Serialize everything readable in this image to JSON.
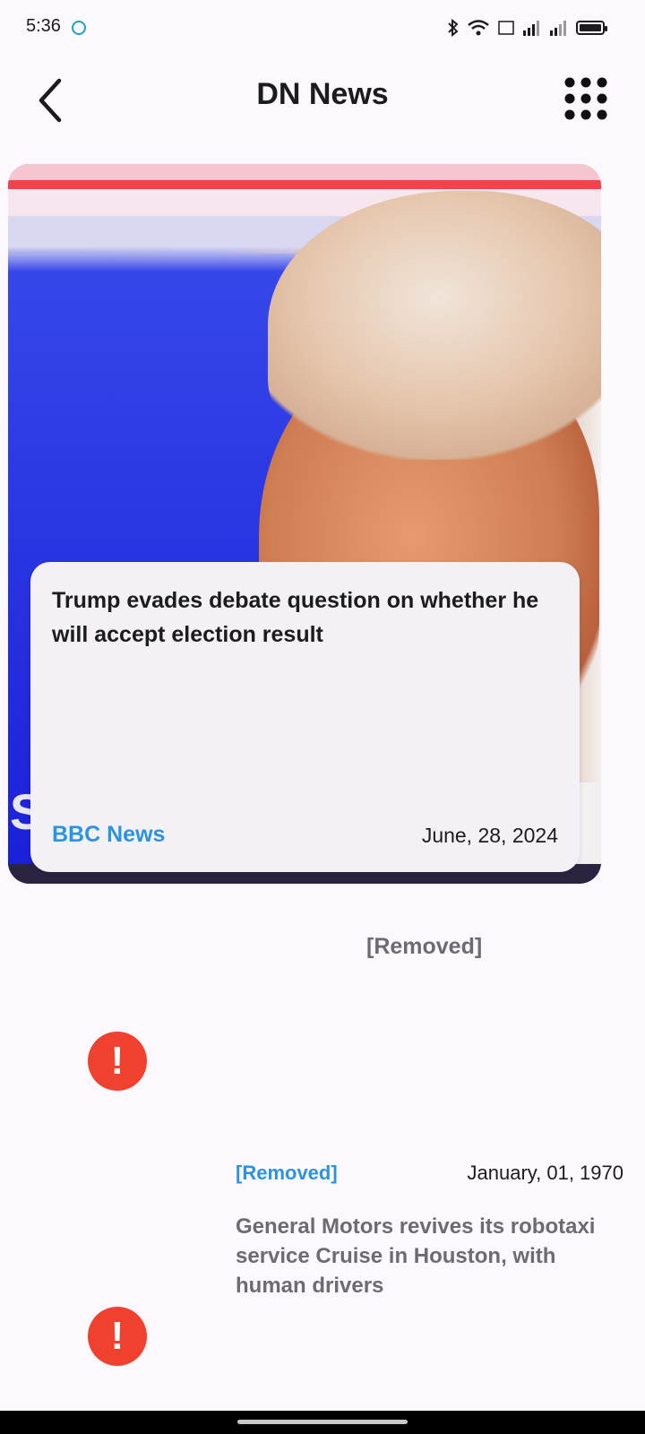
{
  "status_bar": {
    "time": "5:36",
    "icons": [
      "app-notification-icon",
      "bluetooth-icon",
      "wifi-icon",
      "volte-icon",
      "signal-icon",
      "signal-icon",
      "battery-icon"
    ],
    "battery_level": 1.0
  },
  "header": {
    "title": "DN News",
    "back_icon": "chevron-left-icon",
    "menu_icon": "grid-dots-icon"
  },
  "featured": {
    "title": "Trump evades debate question on whether he will accept election result",
    "source": "BBC News",
    "date": "June, 28, 2024",
    "photo_letter": "S"
  },
  "list": [
    {
      "title": "[Removed]",
      "icon": "error-icon"
    },
    {
      "source": "[Removed]",
      "date": "January, 01, 1970",
      "title": "General Motors revives its robotaxi service Cruise in Houston, with human drivers",
      "icon": "error-icon"
    }
  ],
  "colors": {
    "accent": "#2a94e2",
    "error": "#f0412f",
    "muted": "#6d6b72",
    "background": "#fdf8fd"
  }
}
